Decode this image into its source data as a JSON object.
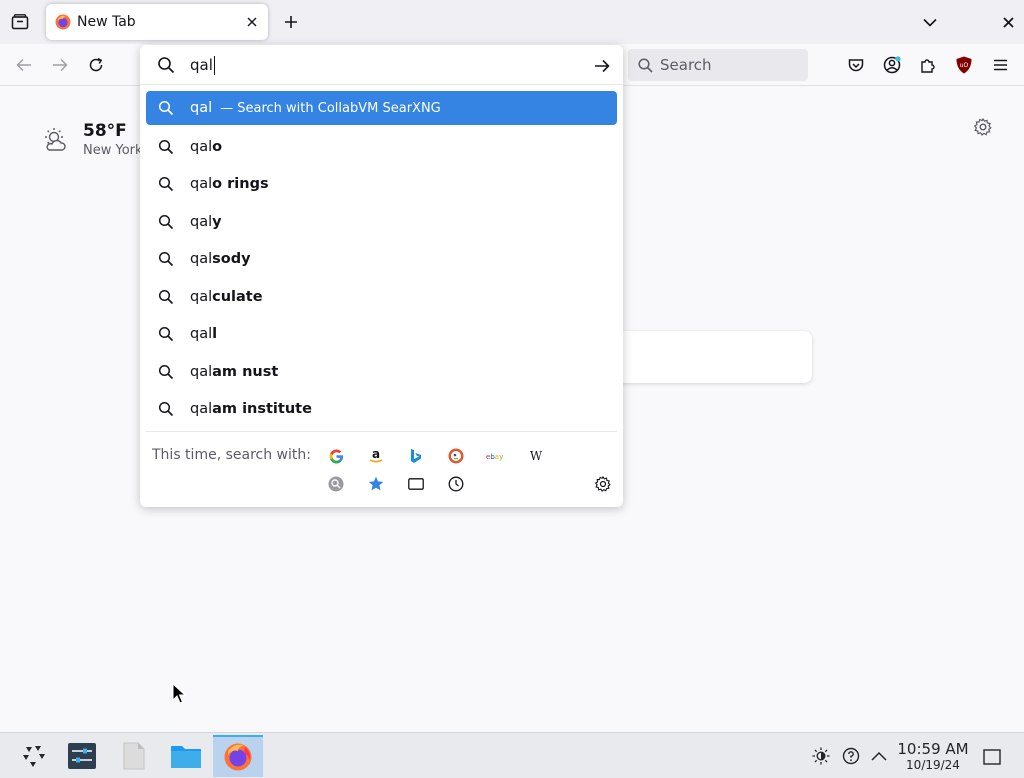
{
  "browser": {
    "tab": {
      "title": "New Tab"
    },
    "search_bar": {
      "placeholder": "Search"
    }
  },
  "urlbar": {
    "typed_value": "qal",
    "results": [
      {
        "prefix": "qal",
        "suffix": "",
        "action": "— Search with CollabVM SearXNG",
        "selected": true
      },
      {
        "prefix": "qal",
        "suffix": "o"
      },
      {
        "prefix": "qal",
        "suffix": "o rings"
      },
      {
        "prefix": "qal",
        "suffix": "y"
      },
      {
        "prefix": "qal",
        "suffix": "sody"
      },
      {
        "prefix": "qal",
        "suffix": "culate"
      },
      {
        "prefix": "qal",
        "suffix": "l"
      },
      {
        "prefix": "qal",
        "suffix": "am nust"
      },
      {
        "prefix": "qal",
        "suffix": "am institute"
      }
    ],
    "oneoff_label": "This time, search with:",
    "engines": [
      "google-icon",
      "amazon-icon",
      "bing-icon",
      "duckduckgo-icon",
      "ebay-icon",
      "wikipedia-icon",
      "searxng-icon",
      "bookmarks-icon",
      "tabs-icon",
      "history-icon"
    ]
  },
  "newtab": {
    "weather": {
      "temp": "58°F",
      "city": "New York"
    }
  },
  "taskbar": {
    "time": "10:59 AM",
    "date": "10/19/24"
  },
  "colors": {
    "accent": "#3584e4",
    "tab_strip": "#f0f0f4",
    "taskbar": "#e8eaed"
  }
}
